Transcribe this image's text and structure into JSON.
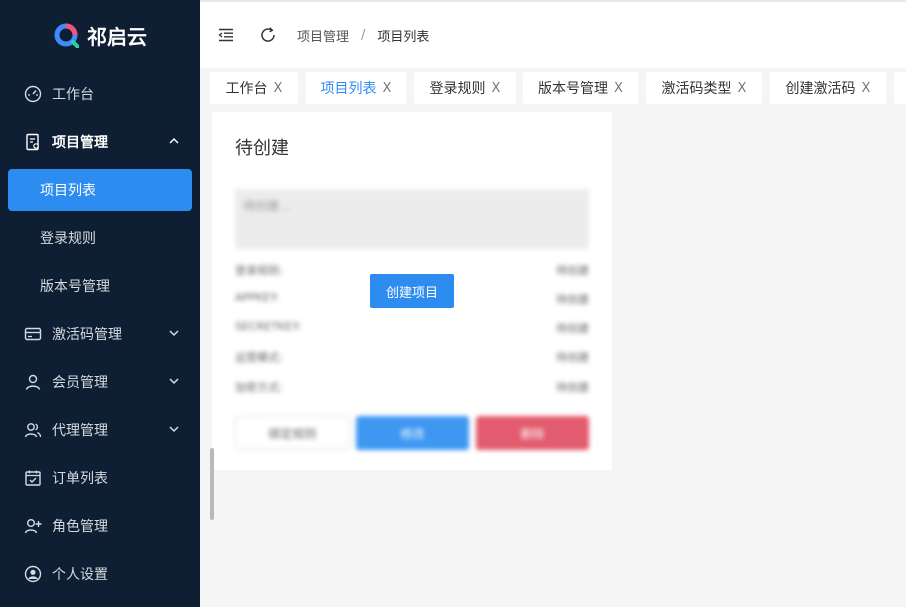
{
  "app": {
    "name": "祁启云"
  },
  "sidebar": {
    "items": [
      {
        "label": "工作台",
        "icon": "dashboard-icon"
      },
      {
        "label": "项目管理",
        "icon": "project-icon",
        "expanded": true
      },
      {
        "label": "项目列表",
        "active": true
      },
      {
        "label": "登录规则"
      },
      {
        "label": "版本号管理"
      },
      {
        "label": "激活码管理",
        "icon": "card-icon"
      },
      {
        "label": "会员管理",
        "icon": "user-icon"
      },
      {
        "label": "代理管理",
        "icon": "users-icon"
      },
      {
        "label": "订单列表",
        "icon": "calendar-check-icon"
      },
      {
        "label": "角色管理",
        "icon": "user-add-icon"
      },
      {
        "label": "个人设置",
        "icon": "account-circle-icon"
      }
    ]
  },
  "header": {
    "breadcrumb": [
      "项目管理",
      "项目列表"
    ],
    "separator": "/"
  },
  "tabs": [
    {
      "label": "工作台",
      "close": "X"
    },
    {
      "label": "项目列表",
      "close": "X",
      "active": true
    },
    {
      "label": "登录规则",
      "close": "X"
    },
    {
      "label": "版本号管理",
      "close": "X"
    },
    {
      "label": "激活码类型",
      "close": "X"
    },
    {
      "label": "创建激活码",
      "close": "X"
    }
  ],
  "card": {
    "title": "待创建",
    "placeholder": "待创建...",
    "rows": [
      {
        "key": "登录规则:",
        "value": "待创建"
      },
      {
        "key": "APPKEY:",
        "value": "待创建"
      },
      {
        "key": "SECRETKEY:",
        "value": "待创建"
      },
      {
        "key": "运营模式:",
        "value": "待创建"
      },
      {
        "key": "加密方式:",
        "value": "待创建"
      }
    ],
    "buttons": {
      "rule": "绑定规则",
      "edit": "修改",
      "delete": "删除"
    },
    "create_label": "创建项目"
  },
  "colors": {
    "sidebar_bg": "#0f1f33",
    "accent": "#2d8cf0",
    "danger": "#e25b6e"
  }
}
